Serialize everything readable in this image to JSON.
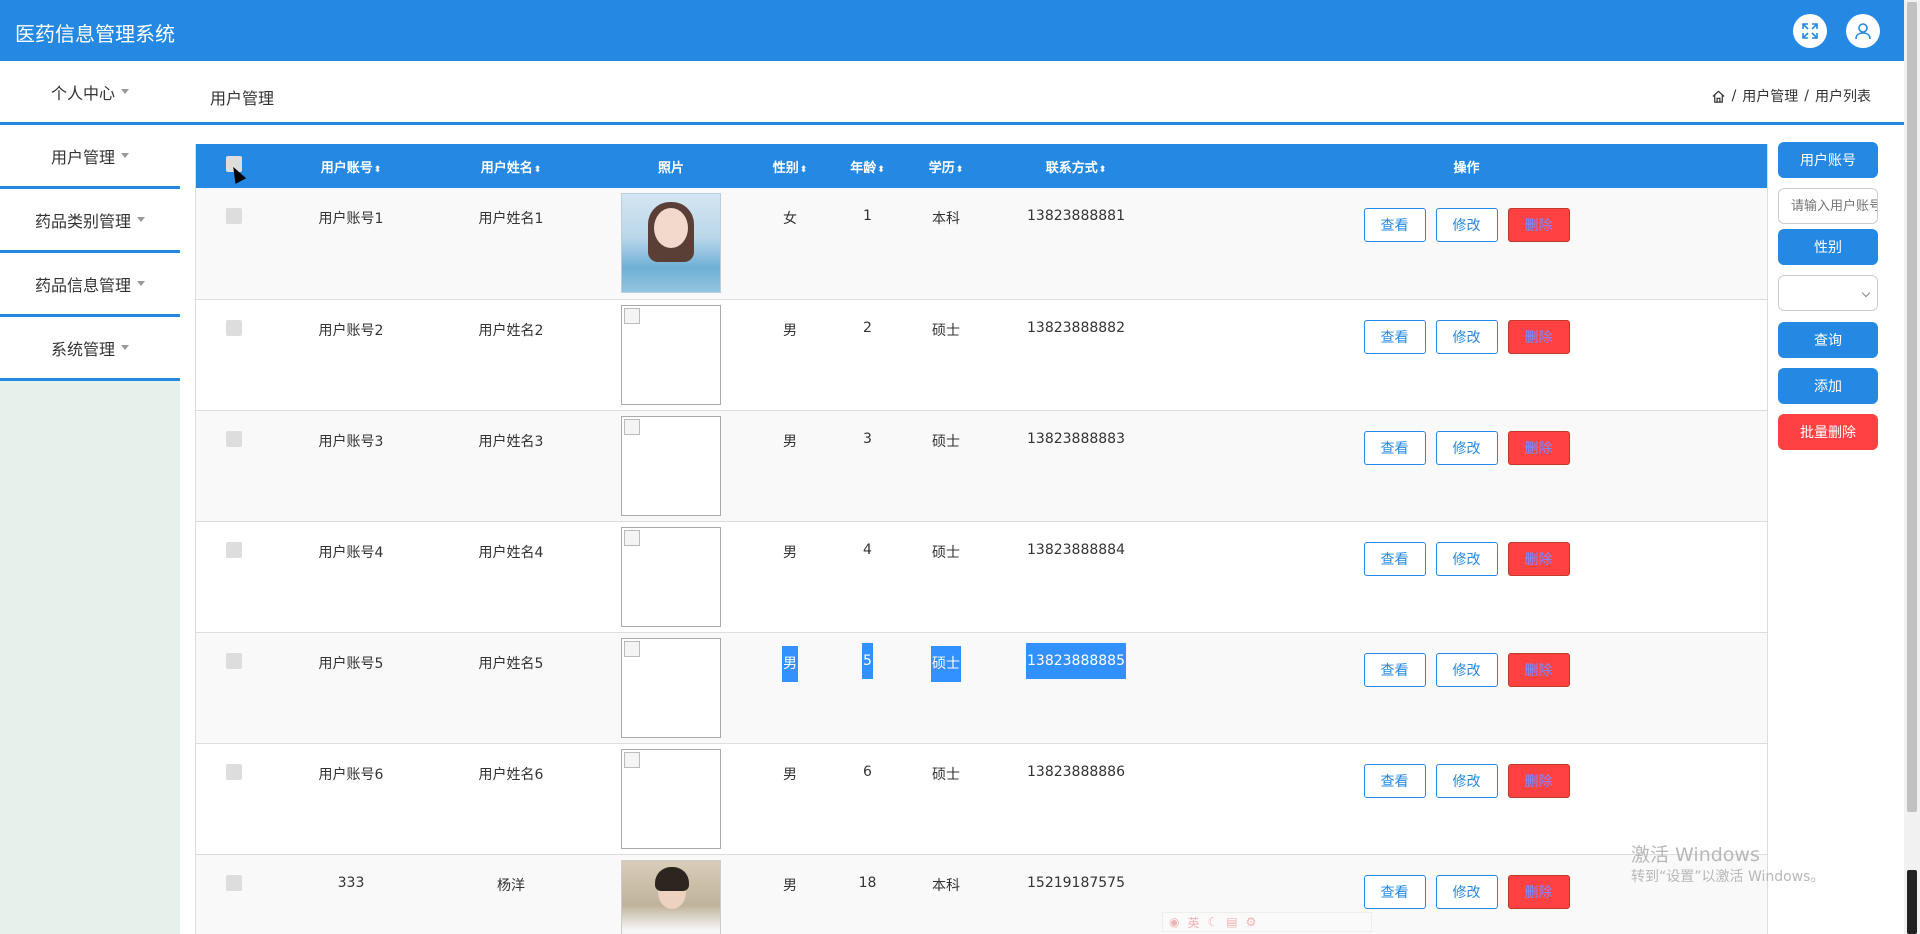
{
  "app": {
    "title": "医药信息管理系统"
  },
  "topbar": {
    "fullscreen_icon": "expand-icon",
    "user_icon": "user-icon"
  },
  "sidebar": {
    "items": [
      {
        "label": "个人中心"
      },
      {
        "label": "用户管理"
      },
      {
        "label": "药品类别管理"
      },
      {
        "label": "药品信息管理"
      },
      {
        "label": "系统管理"
      }
    ]
  },
  "header": {
    "title": "用户管理",
    "breadcrumb": {
      "home_icon": "home-icon",
      "sep1": "/",
      "item1": "用户管理",
      "sep2": "/",
      "item2": "用户列表"
    }
  },
  "table": {
    "columns": {
      "account": "用户账号",
      "name": "用户姓名",
      "photo": "照片",
      "gender": "性别",
      "age": "年龄",
      "education": "学历",
      "phone": "联系方式",
      "actions": "操作",
      "sort_glyph": "⬍"
    },
    "action_labels": {
      "view": "查看",
      "edit": "修改",
      "delete": "删除"
    },
    "rows": [
      {
        "account": "用户账号1",
        "name": "用户姓名1",
        "gender": "女",
        "age": "1",
        "education": "本科",
        "phone": "13823888881"
      },
      {
        "account": "用户账号2",
        "name": "用户姓名2",
        "gender": "男",
        "age": "2",
        "education": "硕士",
        "phone": "13823888882"
      },
      {
        "account": "用户账号3",
        "name": "用户姓名3",
        "gender": "男",
        "age": "3",
        "education": "硕士",
        "phone": "13823888883"
      },
      {
        "account": "用户账号4",
        "name": "用户姓名4",
        "gender": "男",
        "age": "4",
        "education": "硕士",
        "phone": "13823888884"
      },
      {
        "account": "用户账号5",
        "name": "用户姓名5",
        "gender": "男",
        "age": "5",
        "education": "硕士",
        "phone": "13823888885"
      },
      {
        "account": "用户账号6",
        "name": "用户姓名6",
        "gender": "男",
        "age": "6",
        "education": "硕士",
        "phone": "13823888886"
      },
      {
        "account": "333",
        "name": "杨洋",
        "gender": "男",
        "age": "18",
        "education": "本科",
        "phone": "15219187575"
      }
    ]
  },
  "search_panel": {
    "account_label": "用户账号",
    "account_placeholder": "请输入用户账号",
    "gender_label": "性别",
    "gender_selected": "",
    "query_button": "查询",
    "add_button": "添加",
    "batch_delete_button": "批量删除"
  },
  "watermark": {
    "line1": "激活 Windows",
    "line2": "转到“设置”以激活 Windows。"
  },
  "ime": {
    "mode": "英"
  },
  "colors": {
    "primary": "#2589e4",
    "danger": "#ff4141",
    "sidebar_bg": "#e7f1ec"
  }
}
